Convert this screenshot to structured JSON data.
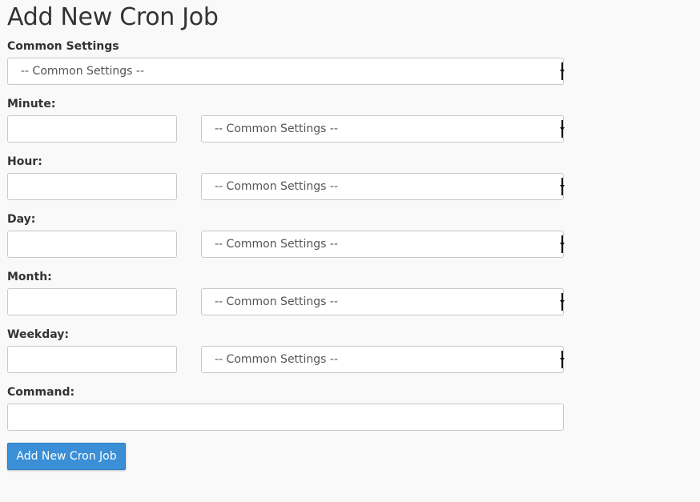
{
  "title": "Add New Cron Job",
  "common": {
    "label": "Common Settings",
    "value": "-- Common Settings --"
  },
  "fields": [
    {
      "label": "Minute:",
      "input_value": "",
      "select_value": "-- Common Settings --"
    },
    {
      "label": "Hour:",
      "input_value": "",
      "select_value": "-- Common Settings --"
    },
    {
      "label": "Day:",
      "input_value": "",
      "select_value": "-- Common Settings --"
    },
    {
      "label": "Month:",
      "input_value": "",
      "select_value": "-- Common Settings --"
    },
    {
      "label": "Weekday:",
      "input_value": "",
      "select_value": "-- Common Settings --"
    }
  ],
  "command": {
    "label": "Command:",
    "value": ""
  },
  "submit": {
    "label": "Add New Cron Job",
    "color": "#3a8fd6"
  }
}
